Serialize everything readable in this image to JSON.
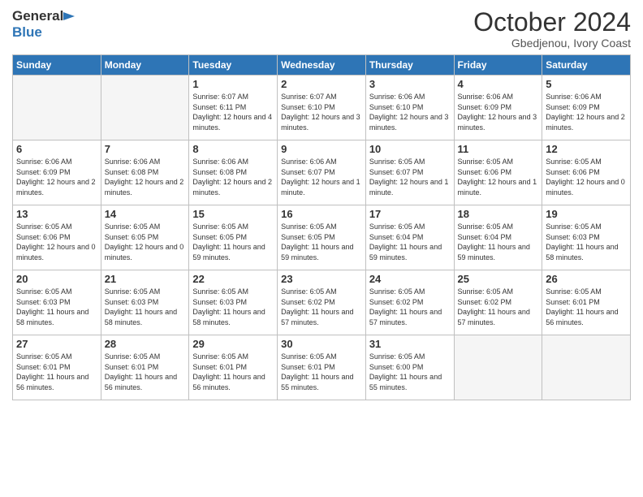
{
  "logo": {
    "general": "General",
    "blue": "Blue"
  },
  "header": {
    "month": "October 2024",
    "location": "Gbedjenou, Ivory Coast"
  },
  "weekdays": [
    "Sunday",
    "Monday",
    "Tuesday",
    "Wednesday",
    "Thursday",
    "Friday",
    "Saturday"
  ],
  "weeks": [
    [
      {
        "day": "",
        "empty": true
      },
      {
        "day": "",
        "empty": true
      },
      {
        "day": "1",
        "sunrise": "6:07 AM",
        "sunset": "6:11 PM",
        "daylight": "12 hours and 4 minutes."
      },
      {
        "day": "2",
        "sunrise": "6:07 AM",
        "sunset": "6:10 PM",
        "daylight": "12 hours and 3 minutes."
      },
      {
        "day": "3",
        "sunrise": "6:06 AM",
        "sunset": "6:10 PM",
        "daylight": "12 hours and 3 minutes."
      },
      {
        "day": "4",
        "sunrise": "6:06 AM",
        "sunset": "6:09 PM",
        "daylight": "12 hours and 3 minutes."
      },
      {
        "day": "5",
        "sunrise": "6:06 AM",
        "sunset": "6:09 PM",
        "daylight": "12 hours and 2 minutes."
      }
    ],
    [
      {
        "day": "6",
        "sunrise": "6:06 AM",
        "sunset": "6:09 PM",
        "daylight": "12 hours and 2 minutes."
      },
      {
        "day": "7",
        "sunrise": "6:06 AM",
        "sunset": "6:08 PM",
        "daylight": "12 hours and 2 minutes."
      },
      {
        "day": "8",
        "sunrise": "6:06 AM",
        "sunset": "6:08 PM",
        "daylight": "12 hours and 2 minutes."
      },
      {
        "day": "9",
        "sunrise": "6:06 AM",
        "sunset": "6:07 PM",
        "daylight": "12 hours and 1 minute."
      },
      {
        "day": "10",
        "sunrise": "6:05 AM",
        "sunset": "6:07 PM",
        "daylight": "12 hours and 1 minute."
      },
      {
        "day": "11",
        "sunrise": "6:05 AM",
        "sunset": "6:06 PM",
        "daylight": "12 hours and 1 minute."
      },
      {
        "day": "12",
        "sunrise": "6:05 AM",
        "sunset": "6:06 PM",
        "daylight": "12 hours and 0 minutes."
      }
    ],
    [
      {
        "day": "13",
        "sunrise": "6:05 AM",
        "sunset": "6:06 PM",
        "daylight": "12 hours and 0 minutes."
      },
      {
        "day": "14",
        "sunrise": "6:05 AM",
        "sunset": "6:05 PM",
        "daylight": "12 hours and 0 minutes."
      },
      {
        "day": "15",
        "sunrise": "6:05 AM",
        "sunset": "6:05 PM",
        "daylight": "11 hours and 59 minutes."
      },
      {
        "day": "16",
        "sunrise": "6:05 AM",
        "sunset": "6:05 PM",
        "daylight": "11 hours and 59 minutes."
      },
      {
        "day": "17",
        "sunrise": "6:05 AM",
        "sunset": "6:04 PM",
        "daylight": "11 hours and 59 minutes."
      },
      {
        "day": "18",
        "sunrise": "6:05 AM",
        "sunset": "6:04 PM",
        "daylight": "11 hours and 59 minutes."
      },
      {
        "day": "19",
        "sunrise": "6:05 AM",
        "sunset": "6:03 PM",
        "daylight": "11 hours and 58 minutes."
      }
    ],
    [
      {
        "day": "20",
        "sunrise": "6:05 AM",
        "sunset": "6:03 PM",
        "daylight": "11 hours and 58 minutes."
      },
      {
        "day": "21",
        "sunrise": "6:05 AM",
        "sunset": "6:03 PM",
        "daylight": "11 hours and 58 minutes."
      },
      {
        "day": "22",
        "sunrise": "6:05 AM",
        "sunset": "6:03 PM",
        "daylight": "11 hours and 58 minutes."
      },
      {
        "day": "23",
        "sunrise": "6:05 AM",
        "sunset": "6:02 PM",
        "daylight": "11 hours and 57 minutes."
      },
      {
        "day": "24",
        "sunrise": "6:05 AM",
        "sunset": "6:02 PM",
        "daylight": "11 hours and 57 minutes."
      },
      {
        "day": "25",
        "sunrise": "6:05 AM",
        "sunset": "6:02 PM",
        "daylight": "11 hours and 57 minutes."
      },
      {
        "day": "26",
        "sunrise": "6:05 AM",
        "sunset": "6:01 PM",
        "daylight": "11 hours and 56 minutes."
      }
    ],
    [
      {
        "day": "27",
        "sunrise": "6:05 AM",
        "sunset": "6:01 PM",
        "daylight": "11 hours and 56 minutes."
      },
      {
        "day": "28",
        "sunrise": "6:05 AM",
        "sunset": "6:01 PM",
        "daylight": "11 hours and 56 minutes."
      },
      {
        "day": "29",
        "sunrise": "6:05 AM",
        "sunset": "6:01 PM",
        "daylight": "11 hours and 56 minutes."
      },
      {
        "day": "30",
        "sunrise": "6:05 AM",
        "sunset": "6:01 PM",
        "daylight": "11 hours and 55 minutes."
      },
      {
        "day": "31",
        "sunrise": "6:05 AM",
        "sunset": "6:00 PM",
        "daylight": "11 hours and 55 minutes."
      },
      {
        "day": "",
        "empty": true
      },
      {
        "day": "",
        "empty": true
      }
    ]
  ]
}
